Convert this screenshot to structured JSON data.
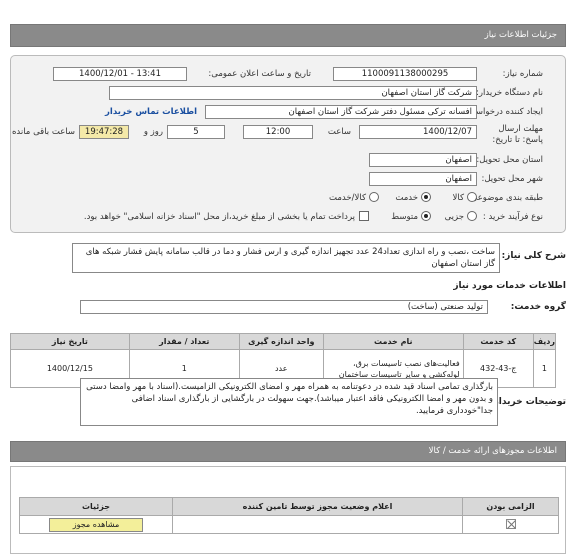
{
  "header": {
    "title": "جزئیات اطلاعات نیاز"
  },
  "form": {
    "need_number_label": "شماره نیاز:",
    "need_number": "1100091138000295",
    "announce_label": "تاریخ و ساعت اعلان عمومی:",
    "announce_value": "1400/12/01 - 13:41",
    "buyer_org_label": "نام دستگاه خریدار:",
    "buyer_org": "شرکت گاز استان اصفهان",
    "creator_label": "ایجاد کننده درخواست:",
    "creator": "افسانه ترکی مسئول دفتر شرکت گاز استان اصفهان",
    "contact_link": "اطلاعات تماس خریدار",
    "deadline_label": "مهلت ارسال پاسخ: تا تاریخ:",
    "deadline_date": "1400/12/07",
    "time_label": "ساعت",
    "deadline_time": "12:00",
    "days_value": "5",
    "days_label": "روز و",
    "remaining_time": "19:47:28",
    "remaining_label": "ساعت باقی مانده",
    "province_label": "استان محل تحویل:",
    "province": "اصفهان",
    "city_label": "شهر محل تحویل:",
    "city": "اصفهان",
    "category_label": "طبقه بندی موضوعی:",
    "category_options": [
      "کالا",
      "خدمت",
      "کالا/خدمت"
    ],
    "process_label": "نوع فرآیند خرید :",
    "process_options": [
      "جزیی",
      "متوسط"
    ],
    "payment_text": "پرداخت تمام یا بخشی از مبلغ خرید،از محل \"اسناد خزانه اسلامی\" خواهد بود."
  },
  "summary": {
    "label": "شرح کلی نیاز:",
    "text": "ساخت ،نصب و راه اندازی تعداد24 عدد تجهیز اندازه گیری و ارس فشار و دما در قالب سامانه پایش فشار شبکه های گاز استان اصفهان"
  },
  "services_title": "اطلاعات خدمات مورد نیاز",
  "service_group_label": "گروه خدمت:",
  "service_group": "تولید صنعتی (ساخت)",
  "services_table": {
    "headers": [
      "ردیف",
      "کد خدمت",
      "نام خدمت",
      "واحد اندازه گیری",
      "تعداد / مقدار",
      "تاریخ نیاز"
    ],
    "rows": [
      [
        "1",
        "ج-43-432",
        "فعالیت‌های نصب تاسیسات برق، لوله‌کشی و سایر تاسیسات ساختمان",
        "عدد",
        "1",
        "1400/12/15"
      ]
    ]
  },
  "notes": {
    "label": "توضیحات خریدار:",
    "text": "بارگذاری تمامی اسناد قید شده در دعوتنامه به همراه مهر و امضای الکترونیکی الزامیست.(اسناد با مهر وامضا دستی و بدون مهر و امضا الکترونیکی فاقد اعتبار میباشد).جهت سهولت در بارگشایی از بارگذاری اسناد اضافی جدا\"خودداری فرمایید."
  },
  "licenses": {
    "title": "اطلاعات مجوزهای ارائه خدمت / کالا",
    "headers": [
      "الزامی بودن",
      "اعلام وضعیت مجوز توسط تامین کننده",
      "جزئیات"
    ],
    "view_button": "مشاهده مجوز"
  }
}
